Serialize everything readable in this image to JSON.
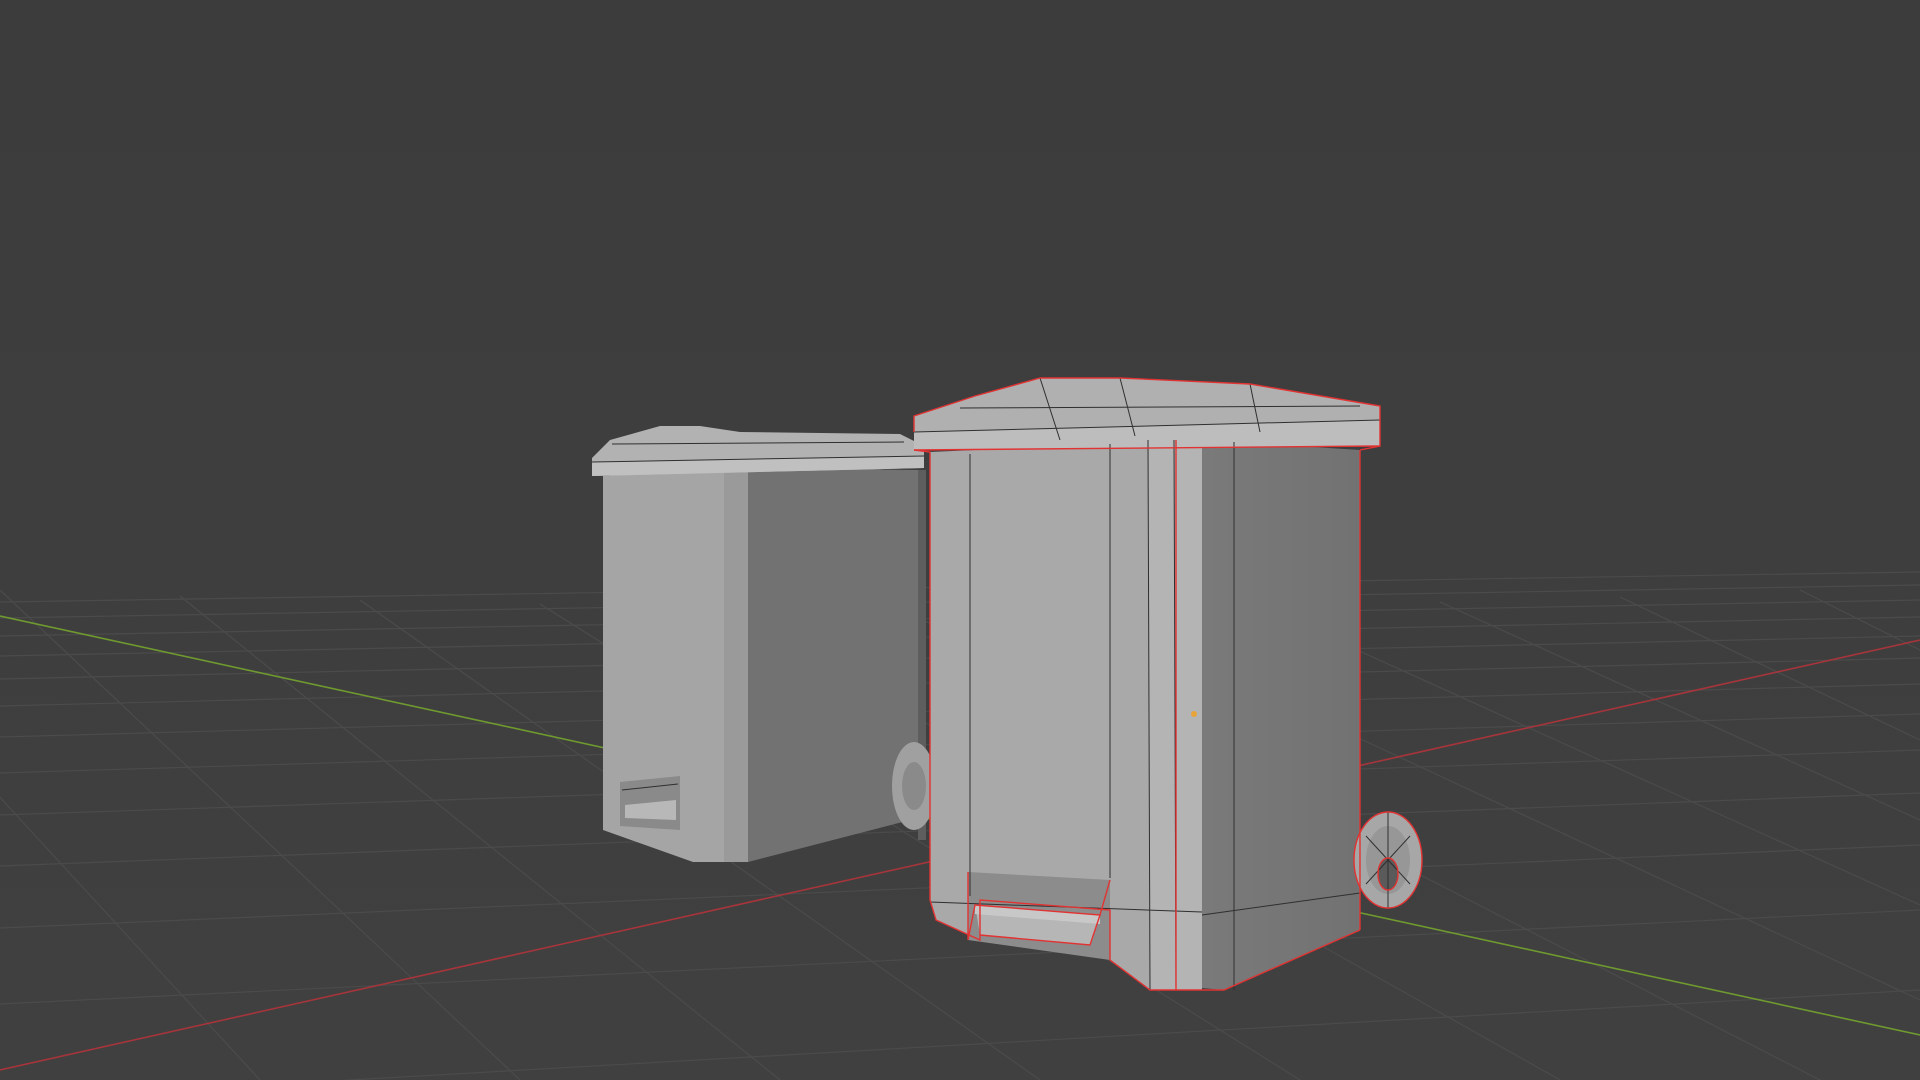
{
  "scene": {
    "background_color": "#3d3d3d",
    "grid_color": "#4b4b4b",
    "x_axis_color": "#a6353b",
    "y_axis_color": "#6f9a2f",
    "selection_outline_color": "#e23333",
    "origin_dot_color": "#e8a43a"
  },
  "objects": [
    {
      "role": "unselected-bin",
      "selected": false,
      "shading": "#a5a5a5"
    },
    {
      "role": "selected-bin",
      "selected": true,
      "shading": "#a9a9a9"
    }
  ]
}
